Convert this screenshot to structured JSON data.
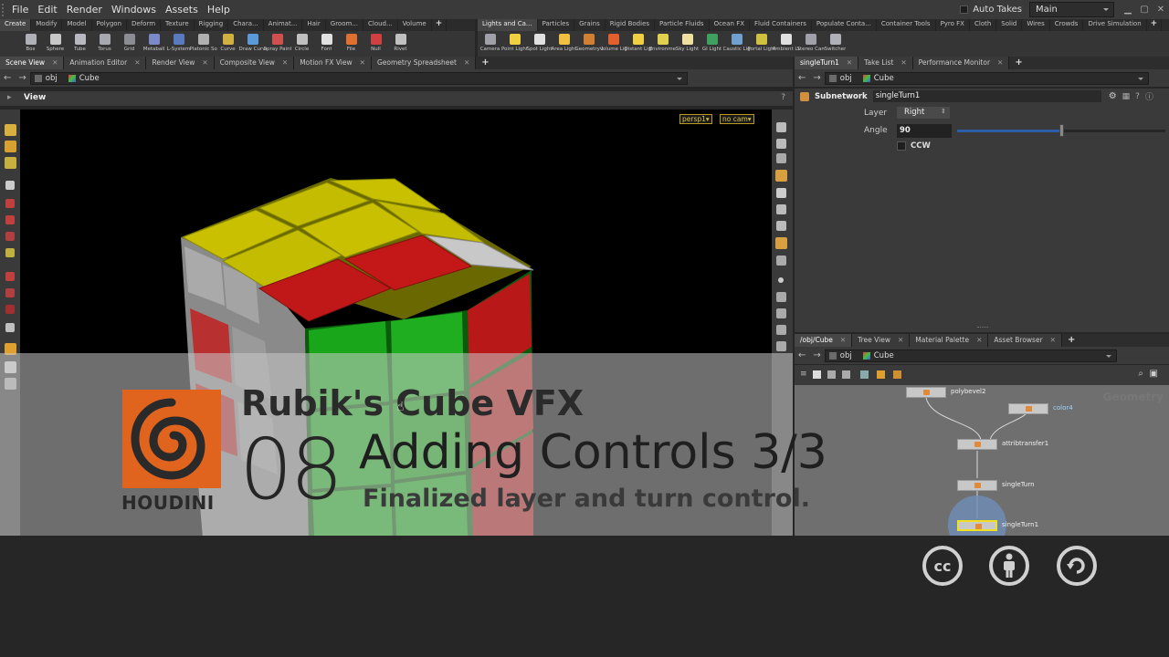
{
  "menubar": {
    "items": [
      "File",
      "Edit",
      "Render",
      "Windows",
      "Assets",
      "Help"
    ],
    "auto_takes": "Auto Takes",
    "desktop": "Main"
  },
  "shelf_left": {
    "tabs": [
      "Create",
      "Modify",
      "Model",
      "Polygon",
      "Deform",
      "Texture",
      "Rigging",
      "Chara...",
      "Animat...",
      "Hair",
      "Groom...",
      "Cloud...",
      "Volume"
    ],
    "tools": [
      {
        "label": "Box",
        "icon": "box-icon",
        "color": "#b0b0b8"
      },
      {
        "label": "Sphere",
        "icon": "sphere-icon",
        "color": "#c8c8c8"
      },
      {
        "label": "Tube",
        "icon": "tube-icon",
        "color": "#b8b8c0"
      },
      {
        "label": "Torus",
        "icon": "torus-icon",
        "color": "#a8a8b0"
      },
      {
        "label": "Grid",
        "icon": "grid-icon",
        "color": "#8c8c94"
      },
      {
        "label": "Metaball",
        "icon": "metaball-icon",
        "color": "#7a8ac8"
      },
      {
        "label": "L-System",
        "icon": "lsystem-icon",
        "color": "#5a7ac0"
      },
      {
        "label": "Platonic Sol...",
        "icon": "platonic-icon",
        "color": "#b0b0b0"
      },
      {
        "label": "Curve",
        "icon": "curve-icon",
        "color": "#d0b040"
      },
      {
        "label": "Draw Curve",
        "icon": "draw-curve-icon",
        "color": "#5a9ad8"
      },
      {
        "label": "Spray Paint",
        "icon": "spray-paint-icon",
        "color": "#d05050"
      },
      {
        "label": "Circle",
        "icon": "circle-icon",
        "color": "#c0c0c0"
      },
      {
        "label": "Font",
        "icon": "font-icon",
        "color": "#e0e0e0"
      },
      {
        "label": "File",
        "icon": "file-icon",
        "color": "#e07030"
      },
      {
        "label": "Null",
        "icon": "null-icon",
        "color": "#d04040"
      },
      {
        "label": "Rivet",
        "icon": "rivet-icon",
        "color": "#c0c0c0"
      }
    ]
  },
  "shelf_right": {
    "tabs": [
      "Lights and Ca...",
      "Particles",
      "Grains",
      "Rigid Bodies",
      "Particle Fluids",
      "Ocean FX",
      "Fluid Containers",
      "Populate Conta...",
      "Container Tools",
      "Pyro FX",
      "Cloth",
      "Solid",
      "Wires",
      "Crowds",
      "Drive Simulation"
    ],
    "tools": [
      {
        "label": "Camera",
        "icon": "camera-icon",
        "color": "#a0a0a8"
      },
      {
        "label": "Point Light",
        "icon": "point-light-icon",
        "color": "#f0d040"
      },
      {
        "label": "Spot Light",
        "icon": "spot-light-icon",
        "color": "#e0e0e0"
      },
      {
        "label": "Area Light",
        "icon": "area-light-icon",
        "color": "#f0c040"
      },
      {
        "label": "Geometry L...",
        "icon": "geometry-light-icon",
        "color": "#d08030"
      },
      {
        "label": "Volume Light",
        "icon": "volume-light-icon",
        "color": "#e06030"
      },
      {
        "label": "Distant Light",
        "icon": "distant-light-icon",
        "color": "#f0d040"
      },
      {
        "label": "Environme...",
        "icon": "environment-light-icon",
        "color": "#e0d050"
      },
      {
        "label": "Sky Light",
        "icon": "sky-light-icon",
        "color": "#f0e0a0"
      },
      {
        "label": "GI Light",
        "icon": "gi-light-icon",
        "color": "#40a060"
      },
      {
        "label": "Caustic Light",
        "icon": "caustic-light-icon",
        "color": "#70a0d0"
      },
      {
        "label": "Portal Light",
        "icon": "portal-light-icon",
        "color": "#d0c040"
      },
      {
        "label": "Ambient Li...",
        "icon": "ambient-light-icon",
        "color": "#e0e0e0"
      },
      {
        "label": "Stereo Cam...",
        "icon": "stereo-camera-icon",
        "color": "#a0a0a8"
      },
      {
        "label": "Switcher",
        "icon": "switcher-icon",
        "color": "#b0b0b8"
      }
    ]
  },
  "left_panetabs": {
    "tabs": [
      "Scene View",
      "Animation Editor",
      "Render View",
      "Composite View",
      "Motion FX View",
      "Geometry Spreadsheet"
    ]
  },
  "right_panetabs": {
    "tabs": [
      "singleTurn1",
      "Take List",
      "Performance Monitor"
    ]
  },
  "net_panetabs": {
    "tabs": [
      "/obj/Cube",
      "Tree View",
      "Material Palette",
      "Asset Browser"
    ]
  },
  "path": {
    "obj": "obj",
    "cube": "Cube"
  },
  "viewport": {
    "title": "View",
    "camera_persp": "persp1▾",
    "camera_nocam": "no cam▾"
  },
  "parameters": {
    "node_type": "Subnetwork",
    "node_name": "singleTurn1",
    "layer_label": "Layer",
    "layer_value": "Right",
    "angle_label": "Angle",
    "angle_value": "90",
    "angle_slider_fraction": 0.5,
    "ccw_label": "CCW",
    "ccw_checked": false
  },
  "network": {
    "watermark": "Geometry",
    "nodes": [
      {
        "name": "polybevel2",
        "selected": false,
        "blue": false
      },
      {
        "name": "color4",
        "selected": false,
        "blue": true
      },
      {
        "name": "attribtransfer1",
        "selected": false,
        "blue": false
      },
      {
        "name": "singleTurn",
        "selected": false,
        "blue": false
      },
      {
        "name": "singleTurn1",
        "selected": true,
        "blue": false
      }
    ]
  },
  "banner": {
    "logo_text": "HOUDINI",
    "series_title": "Rubik's Cube VFX",
    "episode_number": "08",
    "episode_title": "Adding Controls 3/3",
    "episode_subtitle": "Finalized layer and turn control."
  },
  "license": {
    "cc": "cc",
    "by_icon": "attribution-person-icon",
    "sa_icon": "share-alike-icon"
  },
  "colors": {
    "houdini_orange": "#e0641e",
    "cube_yellow": "#c8c000",
    "cube_red": "#c01818",
    "cube_green": "#1aa61a",
    "cube_white": "#c8c8c8"
  }
}
